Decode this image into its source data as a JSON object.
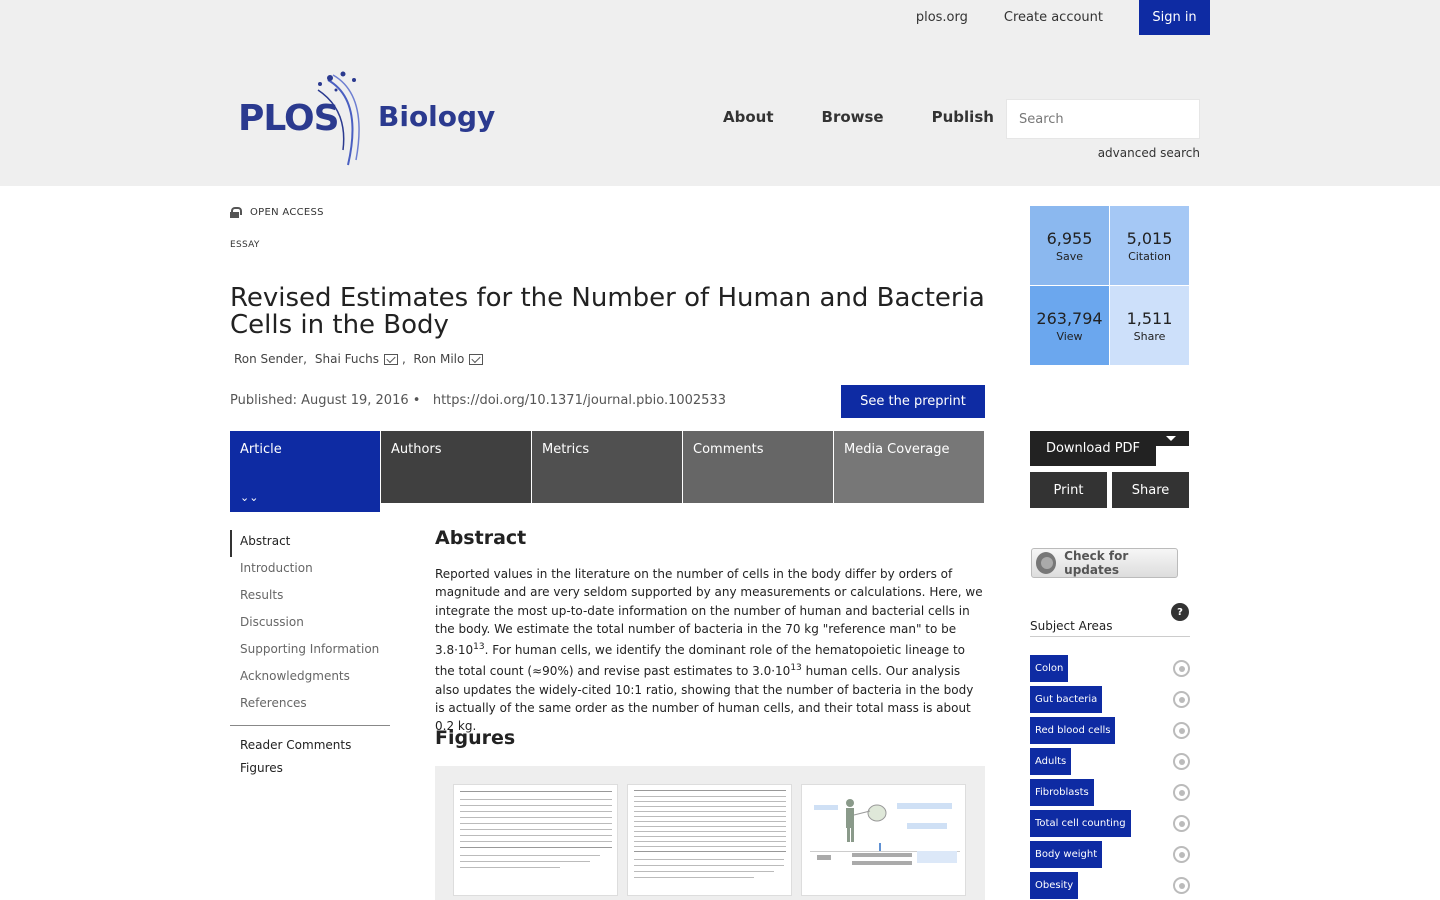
{
  "header": {
    "links": {
      "plos": "plos.org",
      "create": "Create account",
      "signin": "Sign in"
    },
    "logo": {
      "plos": "PLOS",
      "journal": "Biology"
    },
    "nav": {
      "about": "About",
      "browse": "Browse",
      "publish": "Publish"
    },
    "search_placeholder": "Search",
    "advanced": "advanced search"
  },
  "article": {
    "access": "OPEN ACCESS",
    "type": "ESSAY",
    "title": "Revised Estimates for the Number of Human and Bacteria Cells in the Body",
    "authors": [
      "Ron Sender,",
      "Shai Fuchs",
      "Ron Milo"
    ],
    "published": "Published: August 19, 2016",
    "doi": "https://doi.org/10.1371/journal.pbio.1002533",
    "preprint": "See the preprint"
  },
  "tabs": [
    "Article",
    "Authors",
    "Metrics",
    "Comments",
    "Media Coverage"
  ],
  "toc": {
    "items": [
      "Abstract",
      "Introduction",
      "Results",
      "Discussion",
      "Supporting Information",
      "Acknowledgments",
      "References"
    ],
    "extra": [
      "Reader Comments",
      "Figures"
    ]
  },
  "abstract": {
    "heading": "Abstract",
    "p1": "Reported values in the literature on the number of cells in the body differ by orders of magnitude and are very seldom supported by any measurements or calculations. Here, we integrate the most up-to-date information on the number of human and bacterial cells in the body. We estimate the total number of bacteria in the 70 kg \"reference man\" to be 3.8·10",
    "sup1": "13",
    "p2": ". For human cells, we identify the dominant role of the hematopoietic lineage to the total count (≈90%) and revise past estimates to 3.0·10",
    "sup2": "13",
    "p3": " human cells. Our analysis also updates the widely-cited 10:1 ratio, showing that the number of bacteria in the body is actually of the same order as the number of human cells, and their total mass is about 0.2 kg."
  },
  "figures": {
    "heading": "Figures"
  },
  "metrics": [
    {
      "value": "6,955",
      "label": "Save"
    },
    {
      "value": "5,015",
      "label": "Citation"
    },
    {
      "value": "263,794",
      "label": "View"
    },
    {
      "value": "1,511",
      "label": "Share"
    }
  ],
  "actions": {
    "download": "Download PDF",
    "print": "Print",
    "share": "Share",
    "updates": "Check for updates"
  },
  "subjects": {
    "heading": "Subject Areas",
    "items": [
      "Colon",
      "Gut bacteria",
      "Red blood cells",
      "Adults",
      "Fibroblasts",
      "Total cell counting",
      "Body weight",
      "Obesity"
    ]
  }
}
